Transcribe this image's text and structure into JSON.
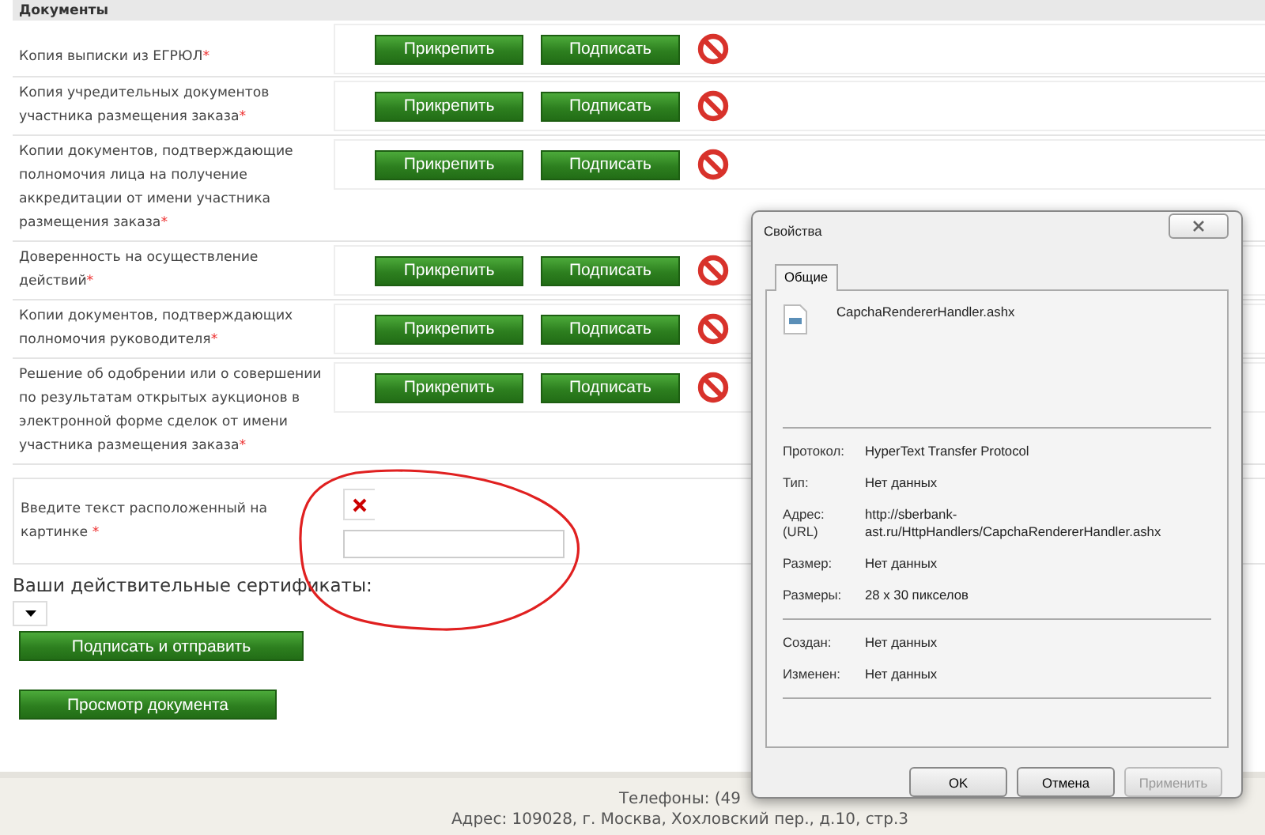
{
  "section_title": "Документы",
  "required_mark": "*",
  "documents": [
    {
      "label": "Копия выписки из ЕГРЮЛ",
      "required": true,
      "attach": "Прикрепить",
      "sign": "Подписать"
    },
    {
      "label": "Копия учредительных документов участника размещения заказа",
      "required": true,
      "attach": "Прикрепить",
      "sign": "Подписать"
    },
    {
      "label": "Копии документов, подтверждающие полномочия лица на получение аккредитации от имени участника размещения заказа",
      "required": true,
      "attach": "Прикрепить",
      "sign": "Подписать"
    },
    {
      "label": "Доверенность на осуществление действий",
      "required": true,
      "attach": "Прикрепить",
      "sign": "Подписать"
    },
    {
      "label": "Копии документов, подтверждающих полномочия руководителя",
      "required": true,
      "attach": "Прикрепить",
      "sign": "Подписать"
    },
    {
      "label": "Решение об одобрении или о совершении по результатам открытых аукционов в электронной форме сделок от имени участника размещения заказа",
      "required": true,
      "attach": "Прикрепить",
      "sign": "Подписать"
    }
  ],
  "captcha": {
    "label": "Введите текст расположенный на картинке",
    "required": true
  },
  "certificates_label": "Ваши действительные сертификаты:",
  "actions": [
    "Подписать и отправить",
    "Просмотр документа"
  ],
  "footer": [
    "Телефоны: (49",
    "Адрес: 109028, г. Москва, Хохловский пер., д.10, стр.3"
  ],
  "dialog": {
    "title": "Свойства",
    "tabs": [
      {
        "label": "Общие",
        "selected": true
      }
    ],
    "file_name": "CapchaRendererHandler.ashx",
    "groups": [
      [
        {
          "label": "Протокол:",
          "value": "HyperText Transfer Protocol"
        },
        {
          "label": "Тип:",
          "value": "Нет данных"
        },
        {
          "label": "Адрес:\n(URL)",
          "value": "http://sberbank-\nast.ru/HttpHandlers/CapchaRendererHandler.ashx"
        },
        {
          "label": "Размер:",
          "value": "Нет данных"
        },
        {
          "label": "Размеры:",
          "value": "28  x  30  пикселов"
        }
      ],
      [
        {
          "label": "Создан:",
          "value": "Нет данных"
        },
        {
          "label": "Изменен:",
          "value": "Нет данных"
        }
      ]
    ],
    "buttons": [
      {
        "label": "OK",
        "disabled": false
      },
      {
        "label": "Отмена",
        "disabled": false
      },
      {
        "label": "Применить",
        "disabled": true
      }
    ]
  }
}
